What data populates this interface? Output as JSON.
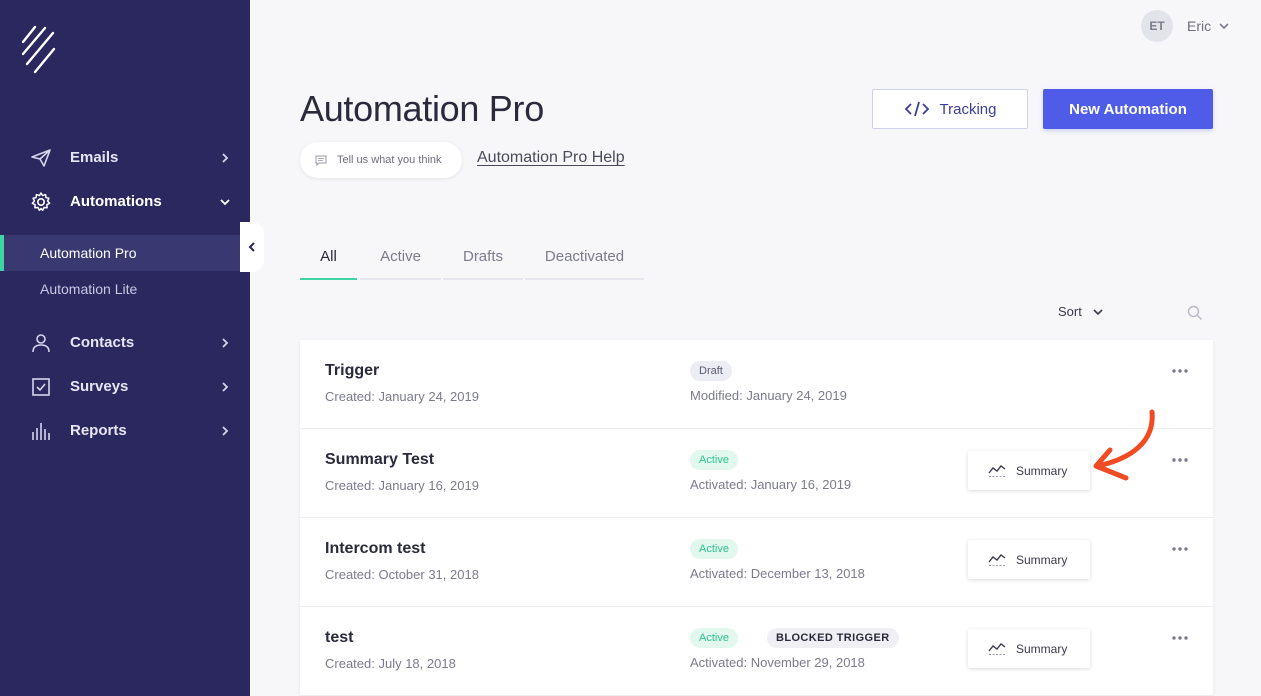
{
  "sidebar": {
    "nav": [
      {
        "label": "Emails",
        "icon": "paper-plane-icon"
      },
      {
        "label": "Automations",
        "icon": "gear-icon"
      },
      {
        "label": "Contacts",
        "icon": "person-icon"
      },
      {
        "label": "Surveys",
        "icon": "checkbox-icon"
      },
      {
        "label": "Reports",
        "icon": "bar-chart-icon"
      }
    ],
    "sub_items": [
      "Automation Pro",
      "Automation Lite"
    ]
  },
  "user": {
    "initials": "ET",
    "name": "Eric"
  },
  "header": {
    "title": "Automation Pro",
    "feedback_label": "Tell us what you think",
    "help_link": "Automation Pro Help",
    "tracking_label": "Tracking",
    "new_label": "New Automation"
  },
  "tabs": [
    "All",
    "Active",
    "Drafts",
    "Deactivated"
  ],
  "sort_label": "Sort",
  "rows": [
    {
      "name": "Trigger",
      "created": "Created: January 24, 2019",
      "status": "Draft",
      "status_date": "Modified: January 24, 2019"
    },
    {
      "name": "Summary Test",
      "created": "Created: January 16, 2019",
      "status": "Active",
      "status_date": "Activated: January 16, 2019",
      "summary": "Summary"
    },
    {
      "name": "Intercom test",
      "created": "Created: October 31, 2018",
      "status": "Active",
      "status_date": "Activated: December 13, 2018",
      "summary": "Summary"
    },
    {
      "name": "test",
      "created": "Created: July 18, 2018",
      "status": "Active",
      "extra_badge": "BLOCKED TRIGGER",
      "status_date": "Activated: November 29, 2018",
      "summary": "Summary"
    }
  ],
  "colors": {
    "sidebar": "#2b2860",
    "accent": "#4e5ce8",
    "active_green": "#3fd4a3",
    "annotation_arrow": "#f04b23"
  }
}
